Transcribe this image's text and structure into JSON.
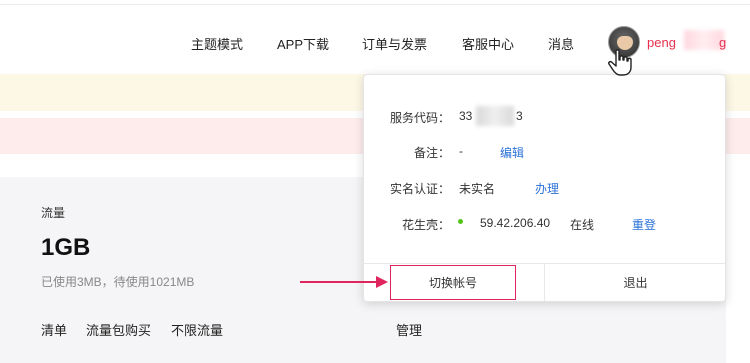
{
  "header": {
    "nav": [
      "主题模式",
      "APP下载",
      "订单与发票",
      "客服中心",
      "消息"
    ],
    "username_start": "peng",
    "username_end": "g"
  },
  "main": {
    "flow_label": "流量",
    "flow_value": "1GB",
    "flow_usage": "已使用3MB，待使用1021MB",
    "tabs": [
      "清单",
      "流量包购买",
      "不限流量"
    ],
    "manage_label": "管理"
  },
  "dropdown": {
    "service_code_label": "服务代码：",
    "service_code_start": "33",
    "service_code_end": "3",
    "remark_label": "备注：",
    "remark_value": "-",
    "edit_link": "编辑",
    "realname_label": "实名认证：",
    "realname_value": "未实名",
    "handle_link": "办理",
    "hsk_label": "花生壳：",
    "hsk_ip": "59.42.206.40",
    "hsk_status": "在线",
    "relogin_link": "重登",
    "switch_account": "切换帐号",
    "logout": "退出"
  },
  "colors": {
    "accent": "#e0245e",
    "link": "#2a72d8",
    "online": "#52c41a",
    "username": "#e8304f"
  },
  "icons": [
    "avatar",
    "hand-pointer-cursor-icon",
    "arrow-right-icon",
    "status-dot-icon"
  ]
}
